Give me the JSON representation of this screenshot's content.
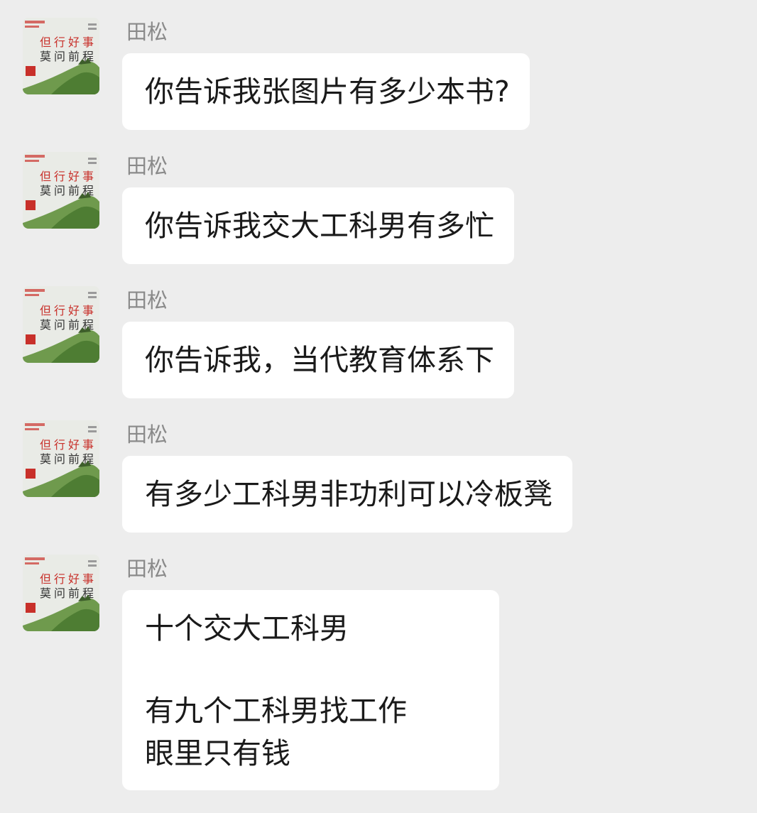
{
  "chat": {
    "messages": [
      {
        "sender": "田松",
        "lines": [
          "你告诉我张图片有多少本书?"
        ]
      },
      {
        "sender": "田松",
        "lines": [
          "你告诉我交大工科男有多忙"
        ]
      },
      {
        "sender": "田松",
        "lines": [
          "你告诉我，当代教育体系下"
        ]
      },
      {
        "sender": "田松",
        "lines": [
          "有多少工科男非功利可以冷板凳"
        ]
      },
      {
        "sender": "田松",
        "lines": [
          "十个交大工科男",
          "",
          "有九个工科男找工作",
          "眼里只有钱"
        ]
      }
    ],
    "avatar": {
      "line1": "但行好事",
      "line2": "莫问前程",
      "accent": "#c8302a",
      "hill": "#5e8f3e"
    }
  }
}
